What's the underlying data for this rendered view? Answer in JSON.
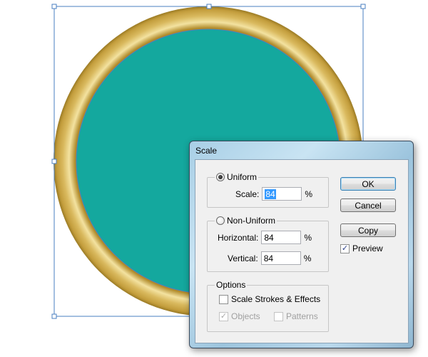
{
  "dialog": {
    "title": "Scale",
    "uniform": {
      "label": "Uniform",
      "selected": true,
      "scale_label": "Scale:",
      "scale_value": "84",
      "unit": "%"
    },
    "non_uniform": {
      "label": "Non-Uniform",
      "selected": false,
      "horizontal_label": "Horizontal:",
      "horizontal_value": "84",
      "vertical_label": "Vertical:",
      "vertical_value": "84",
      "unit": "%"
    },
    "options": {
      "label": "Options",
      "scale_strokes_label": "Scale Strokes & Effects",
      "scale_strokes_checked": false,
      "objects_label": "Objects",
      "objects_checked": true,
      "patterns_label": "Patterns",
      "patterns_checked": false
    },
    "buttons": {
      "ok": "OK",
      "cancel": "Cancel",
      "copy": "Copy"
    },
    "preview": {
      "label": "Preview",
      "checked": true
    }
  },
  "colors": {
    "teal_fill": "#14a89e",
    "gold_ring": "#d9b85a",
    "selection_blue": "#4a7fc1"
  }
}
